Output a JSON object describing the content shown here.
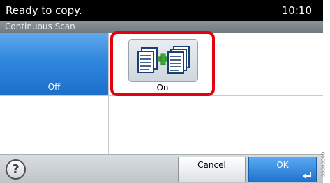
{
  "status": {
    "message": "Ready to copy.",
    "time": "10:10"
  },
  "title": "Continuous Scan",
  "options": [
    {
      "label": "Off",
      "selected": false
    },
    {
      "label": "On",
      "selected": true,
      "icon": "add-documents-icon"
    }
  ],
  "footer": {
    "help_symbol": "?",
    "cancel_label": "Cancel",
    "ok_label": "OK",
    "ok_icon": "enter-arrow-icon"
  },
  "image_code": "G0000000",
  "colors": {
    "accent_blue": "#2f86dc",
    "selection_red": "#e3000f",
    "status_bar": "#000000",
    "title_bar": "#7c848c",
    "plus_green": "#3aa832"
  }
}
